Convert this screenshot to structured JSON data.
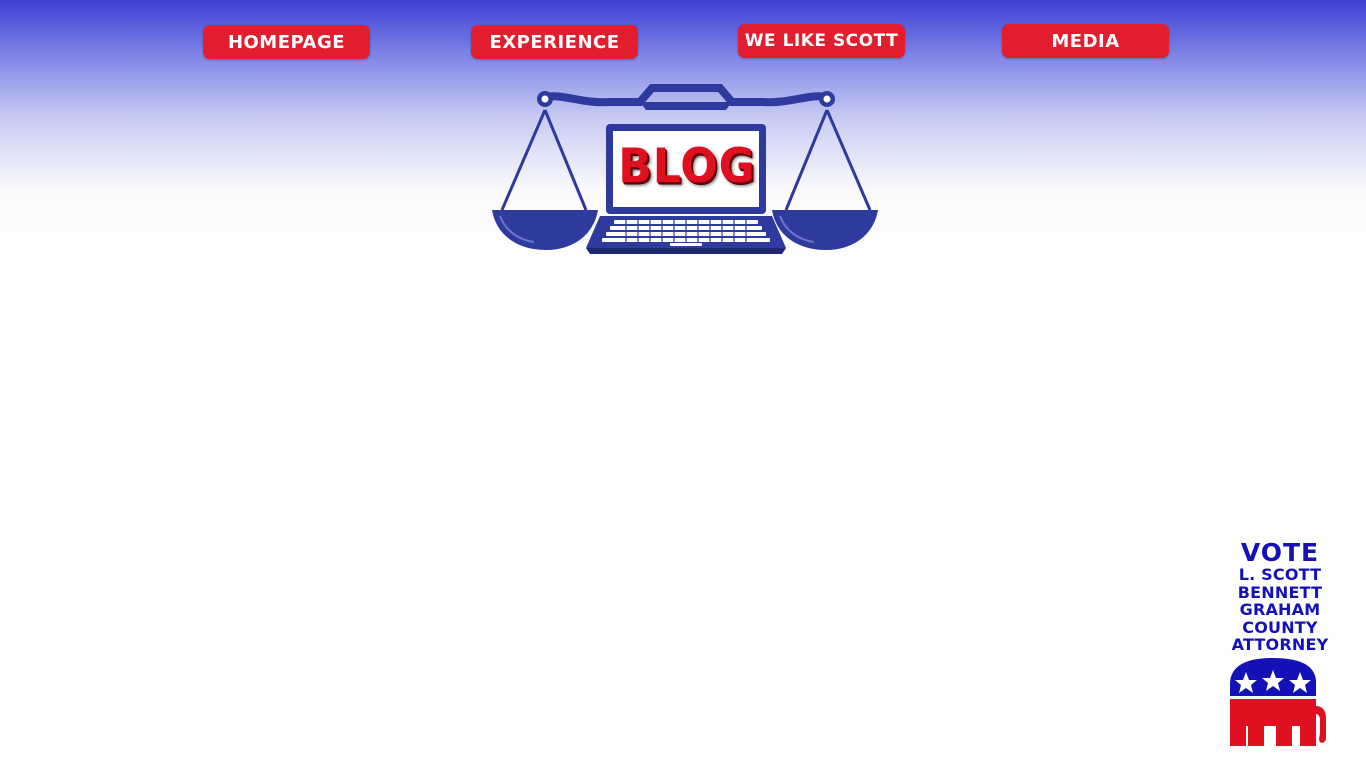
{
  "nav": {
    "items": [
      {
        "label": "HOMEPAGE"
      },
      {
        "label": "EXPERIENCE"
      },
      {
        "label": "WE LIKE SCOTT"
      },
      {
        "label": "MEDIA"
      }
    ]
  },
  "logo": {
    "text": "BLOG",
    "icon": "scales-of-justice-with-laptop"
  },
  "campaign": {
    "title": "VOTE",
    "lines": [
      "L. SCOTT",
      "BENNETT",
      "GRAHAM",
      "COUNTY",
      "ATTORNEY"
    ],
    "icon": "republican-elephant"
  },
  "colors": {
    "button_red": "#e11d2e",
    "brand_blue": "#2e3a9e",
    "vote_blue": "#1511b8",
    "elephant_red": "#e01020"
  }
}
